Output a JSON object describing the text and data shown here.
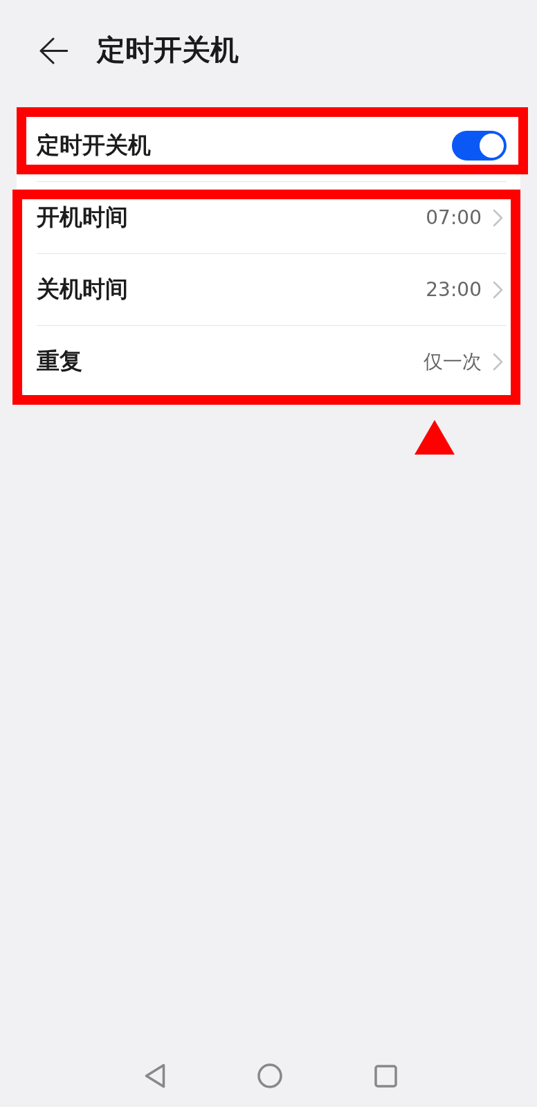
{
  "header": {
    "title": "定时开关机"
  },
  "groups": [
    {
      "highlighted": true,
      "items": [
        {
          "kind": "switch",
          "label": "定时开关机",
          "on": true
        }
      ]
    },
    {
      "highlighted": true,
      "pointer": true,
      "items": [
        {
          "kind": "link",
          "label": "开机时间",
          "value": "07:00"
        },
        {
          "kind": "link",
          "label": "关机时间",
          "value": "23:00"
        },
        {
          "kind": "link",
          "label": "重复",
          "value": "仅一次"
        }
      ]
    }
  ]
}
